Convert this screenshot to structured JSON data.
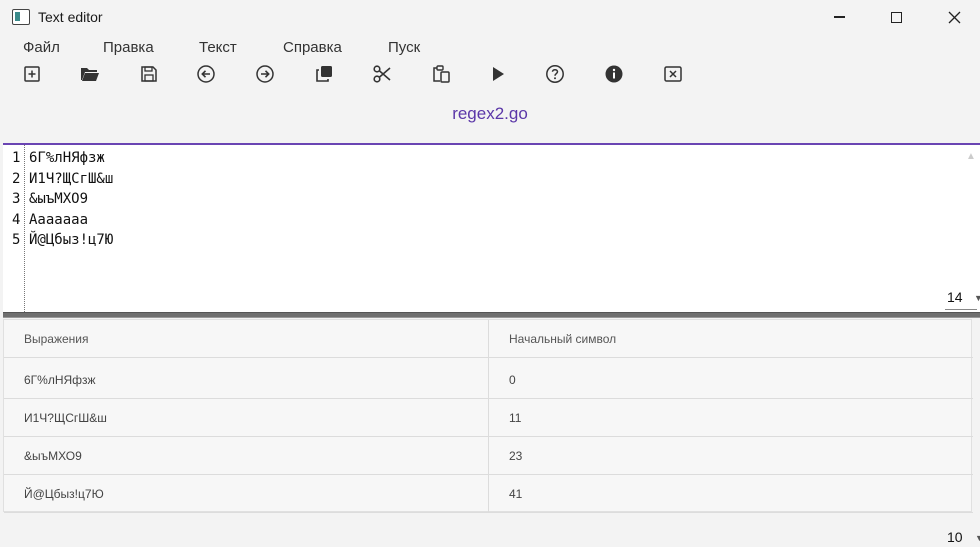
{
  "window": {
    "title": "Text editor"
  },
  "menu": {
    "items": [
      "Файл",
      "Правка",
      "Текст",
      "Справка",
      "Пуск"
    ]
  },
  "toolbar": {
    "icons": [
      "new-file-icon",
      "open-folder-icon",
      "save-icon",
      "undo-icon",
      "redo-icon",
      "copy-icon",
      "cut-icon",
      "paste-icon",
      "run-icon",
      "help-icon",
      "info-icon",
      "close-tab-icon"
    ]
  },
  "document": {
    "tab_name": "regex2.go",
    "accent_color": "#6a44b3"
  },
  "editor": {
    "lines": [
      {
        "num": "1",
        "text": "6Г%лНЯфзж"
      },
      {
        "num": "2",
        "text": "И1Ч?ЩСгШ&ш"
      },
      {
        "num": "3",
        "text": "&ыъМХО9"
      },
      {
        "num": "4",
        "text": "Ааааааа"
      },
      {
        "num": "5",
        "text": "Й@Цбыз!ц7Ю"
      }
    ],
    "font_size": "14"
  },
  "results": {
    "headers": [
      "Выражения",
      "Начальный символ"
    ],
    "rows": [
      [
        "6Г%лНЯфзж",
        "0"
      ],
      [
        "И1Ч?ЩСгШ&ш",
        "11"
      ],
      [
        "&ыъМХО9",
        "23"
      ],
      [
        "Й@Цбыз!ц7Ю",
        "41"
      ]
    ],
    "page_size": "10"
  }
}
